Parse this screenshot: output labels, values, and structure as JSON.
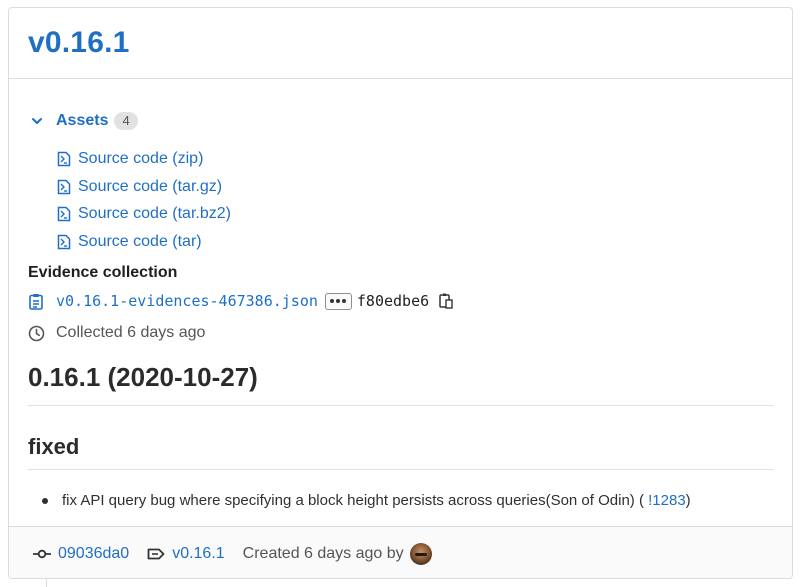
{
  "release": {
    "title": "v0.16.1"
  },
  "assets": {
    "label": "Assets",
    "count": "4",
    "items": [
      {
        "label": "Source code (zip)",
        "icon": "archive-file-icon"
      },
      {
        "label": "Source code (tar.gz)",
        "icon": "archive-file-icon"
      },
      {
        "label": "Source code (tar.bz2)",
        "icon": "archive-file-icon"
      },
      {
        "label": "Source code (tar)",
        "icon": "archive-file-icon"
      }
    ]
  },
  "evidence": {
    "heading": "Evidence collection",
    "file": "v0.16.1-evidences-467386.json",
    "sha": "f80edbe6",
    "collected": "Collected 6 days ago"
  },
  "notes": {
    "heading": "0.16.1 (2020-10-27)",
    "subheading": "fixed",
    "bullet_text": "fix API query bug where specifying a block height persists across queries(Son of Odin) (",
    "bullet_link": "!1283",
    "bullet_close": ")"
  },
  "footer": {
    "commit": "09036da0",
    "tag": "v0.16.1",
    "created": "Created 6 days ago by"
  },
  "colors": {
    "link": "#1f6fc5",
    "text": "#303030",
    "border": "#dcdcdc",
    "footer_bg": "#fafafa"
  }
}
